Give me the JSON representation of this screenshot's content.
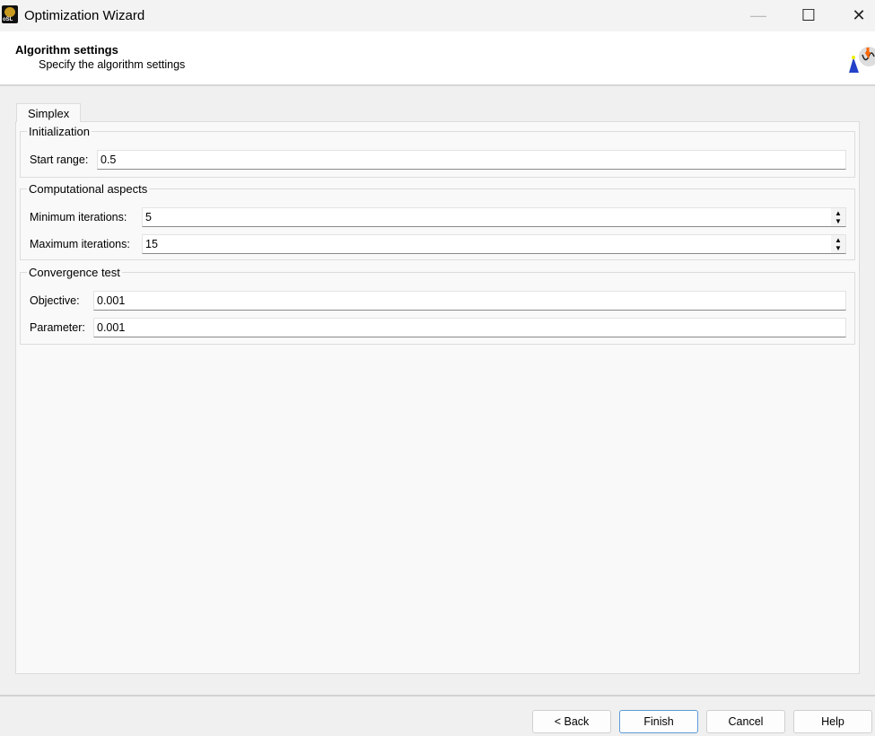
{
  "window": {
    "title": "Optimization Wizard",
    "minimize": "—",
    "maximize": "☐",
    "close": "✕",
    "icon_text": "oSL"
  },
  "header": {
    "title": "Algorithm settings",
    "subtitle": "Specify the algorithm settings"
  },
  "tabs": [
    {
      "label": "Simplex"
    }
  ],
  "groups": {
    "initialization": {
      "title": "Initialization",
      "start_range_label": "Start range:",
      "start_range": "0.5"
    },
    "computational": {
      "title": "Computational aspects",
      "min_label": "Minimum iterations:",
      "min_value": "5",
      "max_label": "Maximum iterations:",
      "max_value": "15"
    },
    "convergence": {
      "title": "Convergence test",
      "objective_label": "Objective:",
      "objective": "0.001",
      "parameter_label": "Parameter:",
      "parameter": "0.001"
    }
  },
  "buttons": {
    "back": "< Back",
    "finish": "Finish",
    "cancel": "Cancel",
    "help": "Help"
  },
  "spin": {
    "up": "▲",
    "down": "▼"
  }
}
